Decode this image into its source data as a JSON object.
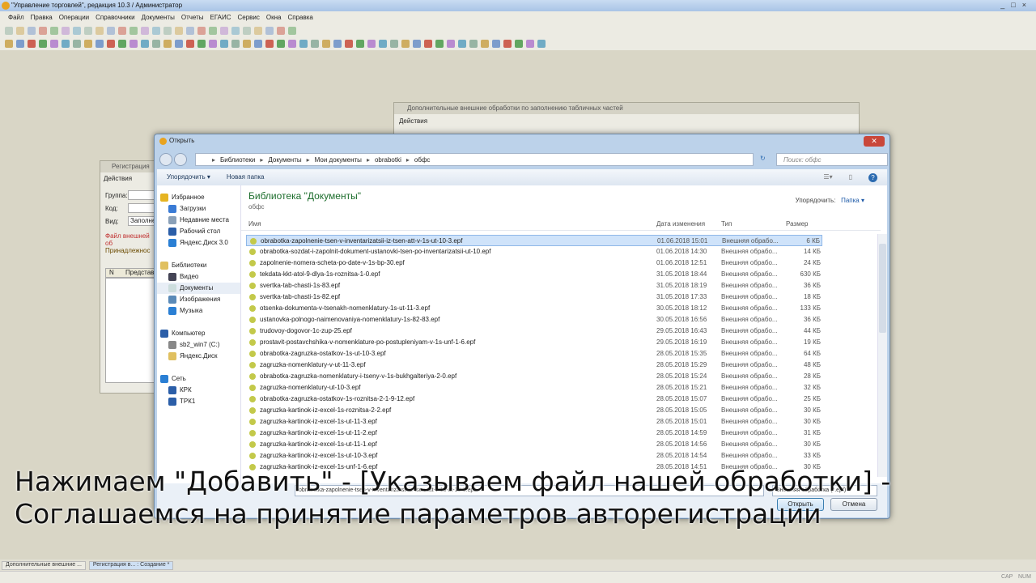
{
  "app": {
    "title": "\"Управление торговлей\", редакция 10.3 / Администратор"
  },
  "menu": [
    "Файл",
    "Правка",
    "Операции",
    "Справочники",
    "Документы",
    "Отчеты",
    "ЕГАИС",
    "Сервис",
    "Окна",
    "Справка"
  ],
  "bg_window_1": {
    "title": "Дополнительные внешние обработки по заполнению табличных частей",
    "actions": "Действия"
  },
  "bg_window_2": {
    "title": "Регистрация",
    "actions": "Действия",
    "group_label": "Группа:",
    "code_label": "Код:",
    "kind_label": "Вид:",
    "kind_value": "Заполнен",
    "error_text": "Файл внешней об",
    "belonging": "Принадлежнос",
    "col_n": "N",
    "col_repr": "Представ"
  },
  "dialog": {
    "title": "Открыть",
    "breadcrumbs": [
      "Библиотеки",
      "Документы",
      "Мои документы",
      "obrabotki",
      "обфс"
    ],
    "search_placeholder": "Поиск: обфс",
    "organize": "Упорядочить ▾",
    "new_folder": "Новая папка",
    "library_title": "Библиотека \"Документы\"",
    "library_sub": "обфс",
    "arrange_label": "Упорядочить:",
    "arrange_value": "Папка ▾",
    "columns": {
      "name": "Имя",
      "date": "Дата изменения",
      "type": "Тип",
      "size": "Размер"
    },
    "nav": [
      {
        "label": "Избранное",
        "group": true,
        "color": "#e6b422"
      },
      {
        "label": "Загрузки",
        "color": "#3a7bd5"
      },
      {
        "label": "Недавние места",
        "color": "#8aa0b8"
      },
      {
        "label": "Рабочий стол",
        "color": "#2b5ea8"
      },
      {
        "label": "Яндекс.Диск 3.0",
        "color": "#2a7fd4"
      },
      {
        "label": "",
        "spacer": true
      },
      {
        "label": "Библиотеки",
        "group": true,
        "color": "#e0c060"
      },
      {
        "label": "Видео",
        "color": "#445"
      },
      {
        "label": "Документы",
        "color": "#cdd",
        "selected": true
      },
      {
        "label": "Изображения",
        "color": "#5a8ab8"
      },
      {
        "label": "Музыка",
        "color": "#2a7fd4"
      },
      {
        "label": "",
        "spacer": true
      },
      {
        "label": "Компьютер",
        "group": true,
        "color": "#2b5ea8"
      },
      {
        "label": "sb2_win7 (C:)",
        "color": "#888"
      },
      {
        "label": "Яндекс.Диск",
        "color": "#e0c060"
      },
      {
        "label": "",
        "spacer": true
      },
      {
        "label": "Сеть",
        "group": true,
        "color": "#2a7fd4"
      },
      {
        "label": "КРК",
        "color": "#2b5ea8"
      },
      {
        "label": "ТРК1",
        "color": "#2b5ea8"
      }
    ],
    "files": [
      {
        "name": "obrabotka-zapolnenie-tsen-v-inventarizatsii-iz-tsen-att-v-1s-ut-10-3.epf",
        "date": "01.06.2018 15:01",
        "type": "Внешняя обрабо...",
        "size": "6 КБ",
        "selected": true
      },
      {
        "name": "obrabotka-sozdat-i-zapolnit-dokument-ustanovki-tsen-po-inventarizatsii-ut-10.epf",
        "date": "01.06.2018 14:30",
        "type": "Внешняя обрабо...",
        "size": "14 КБ"
      },
      {
        "name": "zapolnenie-nomera-scheta-po-date-v-1s-bp-30.epf",
        "date": "01.06.2018 12:51",
        "type": "Внешняя обрабо...",
        "size": "24 КБ"
      },
      {
        "name": "tekdata-kkt-atol-9-dlya-1s-roznitsa-1-0.epf",
        "date": "31.05.2018 18:44",
        "type": "Внешняя обрабо...",
        "size": "630 КБ"
      },
      {
        "name": "svertka-tab-chasti-1s-83.epf",
        "date": "31.05.2018 18:19",
        "type": "Внешняя обрабо...",
        "size": "36 КБ"
      },
      {
        "name": "svertka-tab-chasti-1s-82.epf",
        "date": "31.05.2018 17:33",
        "type": "Внешняя обрабо...",
        "size": "18 КБ"
      },
      {
        "name": "otsenka-dokumenta-v-tsenakh-nomenklatury-1s-ut-11-3.epf",
        "date": "30.05.2018 18:12",
        "type": "Внешняя обрабо...",
        "size": "133 КБ"
      },
      {
        "name": "ustanovka-polnogo-naimenovaniya-nomenklatury-1s-82-83.epf",
        "date": "30.05.2018 16:56",
        "type": "Внешняя обрабо...",
        "size": "36 КБ"
      },
      {
        "name": "trudovoy-dogovor-1c-zup-25.epf",
        "date": "29.05.2018 16:43",
        "type": "Внешняя обрабо...",
        "size": "44 КБ"
      },
      {
        "name": "prostavit-postavchshika-v-nomenklature-po-postupleniyam-v-1s-unf-1-6.epf",
        "date": "29.05.2018 16:19",
        "type": "Внешняя обрабо...",
        "size": "19 КБ"
      },
      {
        "name": "obrabotka-zagruzka-ostatkov-1s-ut-10-3.epf",
        "date": "28.05.2018 15:35",
        "type": "Внешняя обрабо...",
        "size": "64 КБ"
      },
      {
        "name": "zagruzka-nomenklatury-v-ut-11-3.epf",
        "date": "28.05.2018 15:29",
        "type": "Внешняя обрабо...",
        "size": "48 КБ"
      },
      {
        "name": "obrabotka-zagruzka-nomenklatury-i-tseny-v-1s-bukhgalteriya-2-0.epf",
        "date": "28.05.2018 15:24",
        "type": "Внешняя обрабо...",
        "size": "28 КБ"
      },
      {
        "name": "zagruzka-nomenklatury-ut-10-3.epf",
        "date": "28.05.2018 15:21",
        "type": "Внешняя обрабо...",
        "size": "32 КБ"
      },
      {
        "name": "obrabotka-zagruzka-ostatkov-1s-roznitsa-2-1-9-12.epf",
        "date": "28.05.2018 15:07",
        "type": "Внешняя обрабо...",
        "size": "25 КБ"
      },
      {
        "name": "zagruzka-kartinok-iz-excel-1s-roznitsa-2-2.epf",
        "date": "28.05.2018 15:05",
        "type": "Внешняя обрабо...",
        "size": "30 КБ"
      },
      {
        "name": "zagruzka-kartinok-iz-excel-1s-ut-11-3.epf",
        "date": "28.05.2018 15:01",
        "type": "Внешняя обрабо...",
        "size": "30 КБ"
      },
      {
        "name": "zagruzka-kartinok-iz-excel-1s-ut-11-2.epf",
        "date": "28.05.2018 14:59",
        "type": "Внешняя обрабо...",
        "size": "31 КБ"
      },
      {
        "name": "zagruzka-kartinok-iz-excel-1s-ut-11-1.epf",
        "date": "28.05.2018 14:56",
        "type": "Внешняя обрабо...",
        "size": "30 КБ"
      },
      {
        "name": "zagruzka-kartinok-iz-excel-1s-ut-10-3.epf",
        "date": "28.05.2018 14:54",
        "type": "Внешняя обрабо...",
        "size": "33 КБ"
      },
      {
        "name": "zagruzka-kartinok-iz-excel-1s-unf-1-6.epf",
        "date": "28.05.2018 14:51",
        "type": "Внешняя обрабо...",
        "size": "30 КБ"
      }
    ],
    "filename_value": "obrabotka-zapolnenie-tsen-v-inventarizatsii-iz-tsen-att-v-1s-ut-10-3.epf",
    "filetype_value": "Внешняя обработка (*.epf)",
    "open_button": "Открыть",
    "cancel_button": "Отмена"
  },
  "caption": {
    "line1": "Нажимаем \"Добавить\" - [Указываем файл нашей обработки] -",
    "line2": "Соглашаемся на принятие параметров авторегистрации"
  },
  "taskbar": [
    {
      "label": "Дополнительные внешние ..."
    },
    {
      "label": "Регистрация в... : Создание *",
      "active": true
    }
  ],
  "status": {
    "cap": "CAP",
    "num": "NUM"
  }
}
